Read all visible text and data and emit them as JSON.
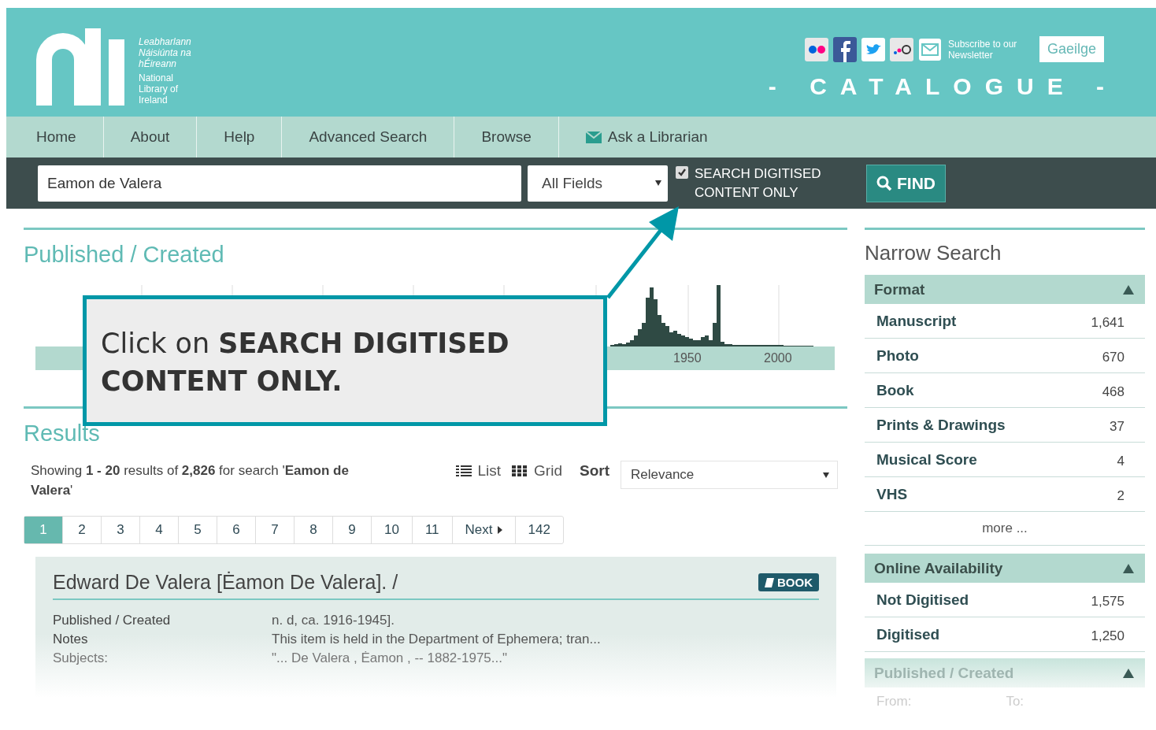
{
  "header": {
    "logo_irish": "Leabharlann Náisiúnta na hÉireann",
    "logo_english": "National Library of Ireland",
    "newsletter": "Subscribe to our Newsletter",
    "language_button": "Gaeilge",
    "catalogue_title": "- CATALOGUE -"
  },
  "nav": [
    {
      "label": "Home",
      "kind": "link"
    },
    {
      "label": "About",
      "kind": "link"
    },
    {
      "label": "Help",
      "kind": "link"
    },
    {
      "label": "Advanced Search",
      "kind": "link"
    },
    {
      "label": "Browse",
      "kind": "link"
    },
    {
      "label": "Ask a Librarian",
      "kind": "mail"
    }
  ],
  "search": {
    "value": "Eamon de Valera",
    "field_select": "All Fields",
    "digitised_only": {
      "label": "SEARCH DIGITISED CONTENT ONLY",
      "checked": true
    },
    "find_button": "FIND"
  },
  "timeline": {
    "title": "Published / Created",
    "axis_labels": [
      "1950",
      "2000"
    ]
  },
  "results": {
    "title": "Results",
    "summary": "Showing **1 - 20** results of **2,826** for search '**Eamon de Valera**'",
    "view_options": [
      {
        "label": "List",
        "kind": "list"
      },
      {
        "label": "Grid",
        "kind": "grid"
      }
    ],
    "sort_label": "Sort",
    "sort_value": "Relevance",
    "pages": [
      {
        "label": "1",
        "selected": true,
        "kind": "page"
      },
      {
        "label": "2",
        "selected": false,
        "kind": "page"
      },
      {
        "label": "3",
        "selected": false,
        "kind": "page"
      },
      {
        "label": "4",
        "selected": false,
        "kind": "page"
      },
      {
        "label": "5",
        "selected": false,
        "kind": "page"
      },
      {
        "label": "6",
        "selected": false,
        "kind": "page"
      },
      {
        "label": "7",
        "selected": false,
        "kind": "page"
      },
      {
        "label": "8",
        "selected": false,
        "kind": "page"
      },
      {
        "label": "9",
        "selected": false,
        "kind": "page"
      },
      {
        "label": "10",
        "selected": false,
        "kind": "page"
      },
      {
        "label": "11",
        "selected": false,
        "kind": "page"
      },
      {
        "label": "Next",
        "selected": false,
        "kind": "next"
      },
      {
        "label": "142",
        "selected": false,
        "kind": "page"
      }
    ],
    "record": {
      "title": "Edward De Valera [Ėamon De Valera]. /",
      "badge": "BOOK",
      "fields": [
        {
          "label": "Published / Created",
          "value": "n. d, ca. 1916-1945]."
        },
        {
          "label": "Notes",
          "value": "This item is held in the Department of Ephemera; tran..."
        },
        {
          "label": "Subjects:",
          "value": "\"... De  Valera , Ėamon , -- 1882-1975...\""
        }
      ]
    }
  },
  "sidebar": {
    "title": "Narrow Search",
    "facets": [
      {
        "title": "Format",
        "expanded": true,
        "items": [
          {
            "label": "Manuscript",
            "count": "1,641"
          },
          {
            "label": "Photo",
            "count": "670"
          },
          {
            "label": "Book",
            "count": "468"
          },
          {
            "label": "Prints & Drawings",
            "count": "37"
          },
          {
            "label": "Musical Score",
            "count": "4"
          },
          {
            "label": "VHS",
            "count": "2"
          }
        ],
        "more": "more ..."
      },
      {
        "title": "Online Availability",
        "expanded": true,
        "items": [
          {
            "label": "Not Digitised",
            "count": "1,575"
          },
          {
            "label": "Digitised",
            "count": "1,250"
          }
        ]
      },
      {
        "title": "Published / Created",
        "expanded": true,
        "from_label": "From:",
        "to_label": "To:"
      }
    ]
  },
  "callout": {
    "text": "Click on **SEARCH DIGITISED CONTENT ONLY.**"
  }
}
